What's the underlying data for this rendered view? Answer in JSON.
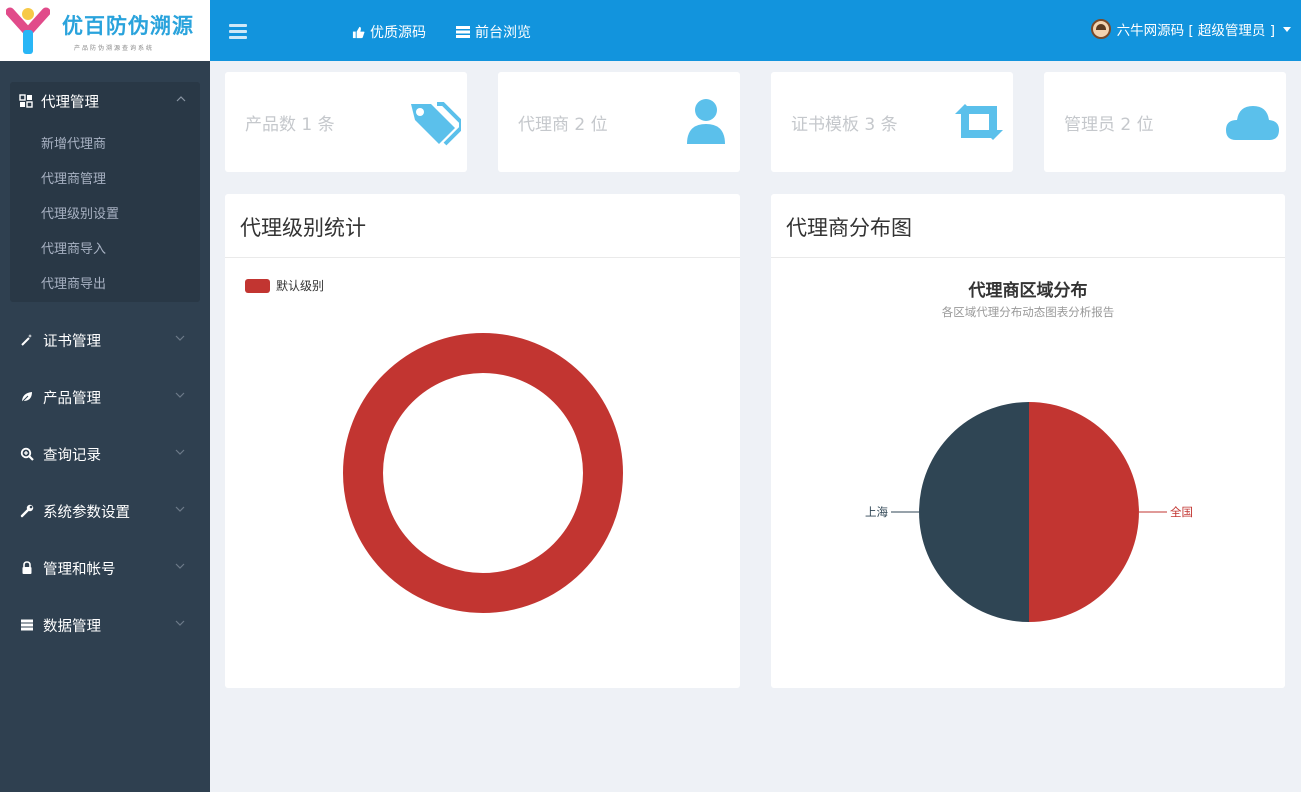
{
  "brand": {
    "title": "优百防伪溯源",
    "subtitle": "产品防伪溯源查询系统"
  },
  "topbar": {
    "links": [
      {
        "label": "优质源码",
        "icon": "thumbs-up-icon"
      },
      {
        "label": "前台浏览",
        "icon": "browser-list-icon"
      }
    ],
    "user": "六牛网源码 [ 超级管理员 ]"
  },
  "sidebar": {
    "active_group": {
      "label": "代理管理",
      "icon": "grid-icon",
      "items": [
        "新增代理商",
        "代理商管理",
        "代理级别设置",
        "代理商导入",
        "代理商导出"
      ]
    },
    "items": [
      {
        "label": "证书管理",
        "icon": "magic-wand-icon"
      },
      {
        "label": "产品管理",
        "icon": "leaf-icon"
      },
      {
        "label": "查询记录",
        "icon": "search-plus-icon"
      },
      {
        "label": "系统参数设置",
        "icon": "wrench-icon"
      },
      {
        "label": "管理和帐号",
        "icon": "lock-icon"
      },
      {
        "label": "数据管理",
        "icon": "server-icon"
      }
    ]
  },
  "stats": [
    {
      "label": "产品数 1 条",
      "icon": "tags-icon"
    },
    {
      "label": "代理商 2 位",
      "icon": "user-icon"
    },
    {
      "label": "证书模板 3 条",
      "icon": "retweet-icon"
    },
    {
      "label": "管理员 2 位",
      "icon": "cloud-icon"
    }
  ],
  "colors": {
    "topbar": "#1294dd",
    "sidebar": "#2f4050",
    "accent_icon": "#5bc0eb",
    "red": "#c23531",
    "navy": "#2f4554"
  },
  "panels": {
    "left_title": "代理级别统计",
    "right_title": "代理商分布图"
  },
  "chart_data": [
    {
      "type": "pie",
      "variant": "donut",
      "title": "",
      "legend": [
        "默认级别"
      ],
      "legend_position": "top-left",
      "slices": [
        {
          "name": "默认级别",
          "value": 1,
          "color": "#c23531"
        }
      ]
    },
    {
      "type": "pie",
      "title": "代理商区域分布",
      "subtitle": "各区域代理分布动态图表分析报告",
      "slices": [
        {
          "name": "全国",
          "value": 1,
          "color": "#c23531"
        },
        {
          "name": "上海",
          "value": 1,
          "color": "#2f4554"
        }
      ]
    }
  ]
}
